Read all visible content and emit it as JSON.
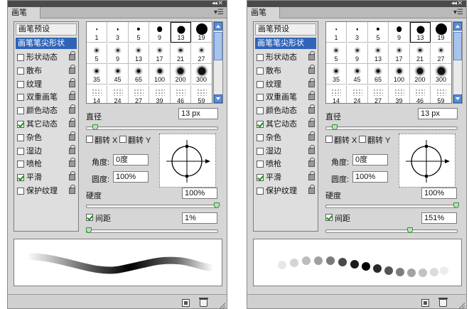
{
  "panels": [
    {
      "id": "left",
      "tab_label": "画笔",
      "menu_icon": "▾☰",
      "collapse_icon": "◂◂ ✕",
      "presets_label": "画笔预设",
      "tip_shape_label": "画笔笔尖形状",
      "options": [
        {
          "label": "形状动态",
          "checked": false
        },
        {
          "label": "散布",
          "checked": false
        },
        {
          "label": "纹理",
          "checked": false
        },
        {
          "label": "双重画笔",
          "checked": false
        },
        {
          "label": "颜色动态",
          "checked": false
        },
        {
          "label": "其它动态",
          "checked": true
        },
        {
          "label": "杂色",
          "checked": false
        },
        {
          "label": "湿边",
          "checked": false
        },
        {
          "label": "喷枪",
          "checked": false
        },
        {
          "label": "平滑",
          "checked": true
        },
        {
          "label": "保护纹理",
          "checked": false
        }
      ],
      "brush_sizes": [
        "1",
        "3",
        "5",
        "9",
        "13",
        "19",
        "5",
        "9",
        "13",
        "17",
        "21",
        "27",
        "35",
        "45",
        "65",
        "100",
        "200",
        "300",
        "14",
        "24",
        "27",
        "39",
        "46",
        "59"
      ],
      "selected_brush": "13",
      "diameter_label": "直径",
      "diameter_value": "13 px",
      "diameter_slider": 0.05,
      "flip_x_label": "翻转 X",
      "flip_y_label": "翻转 Y",
      "angle_label": "角度:",
      "angle_value": "0度",
      "roundness_label": "圆度:",
      "roundness_value": "100%",
      "hardness_label": "硬度",
      "hardness_value": "100%",
      "hardness_slider": 1.0,
      "spacing_label": "间距",
      "spacing_checked": true,
      "spacing_value": "1%",
      "spacing_slider": 0.0,
      "preview_mode": "stroke"
    },
    {
      "id": "right",
      "tab_label": "画笔",
      "menu_icon": "▾☰",
      "collapse_icon": "◂◂ ✕",
      "presets_label": "画笔预设",
      "tip_shape_label": "画笔笔尖形状",
      "options": [
        {
          "label": "形状动态",
          "checked": false
        },
        {
          "label": "散布",
          "checked": false
        },
        {
          "label": "纹理",
          "checked": false
        },
        {
          "label": "双重画笔",
          "checked": false
        },
        {
          "label": "颜色动态",
          "checked": false
        },
        {
          "label": "其它动态",
          "checked": true
        },
        {
          "label": "杂色",
          "checked": false
        },
        {
          "label": "湿边",
          "checked": false
        },
        {
          "label": "喷枪",
          "checked": false
        },
        {
          "label": "平滑",
          "checked": true
        },
        {
          "label": "保护纹理",
          "checked": false
        }
      ],
      "brush_sizes": [
        "1",
        "3",
        "5",
        "9",
        "13",
        "19",
        "5",
        "9",
        "13",
        "17",
        "21",
        "27",
        "35",
        "45",
        "65",
        "100",
        "200",
        "300",
        "14",
        "24",
        "27",
        "39",
        "46",
        "59"
      ],
      "selected_brush": "13",
      "diameter_label": "直径",
      "diameter_value": "13 px",
      "diameter_slider": 0.05,
      "flip_x_label": "翻转 X",
      "flip_y_label": "翻转 Y",
      "angle_label": "角度:",
      "angle_value": "0度",
      "roundness_label": "圆度:",
      "roundness_value": "100%",
      "hardness_label": "硬度",
      "hardness_value": "100%",
      "hardness_slider": 1.0,
      "spacing_label": "间距",
      "spacing_checked": true,
      "spacing_value": "151%",
      "spacing_slider": 0.64,
      "preview_mode": "dots"
    }
  ],
  "colors": {
    "panel_bg": "#d6d6d6",
    "selected_row": "#2f64b8",
    "scroll_blue": "#5b8ed6",
    "slider_knob": "#b8e1b8"
  }
}
